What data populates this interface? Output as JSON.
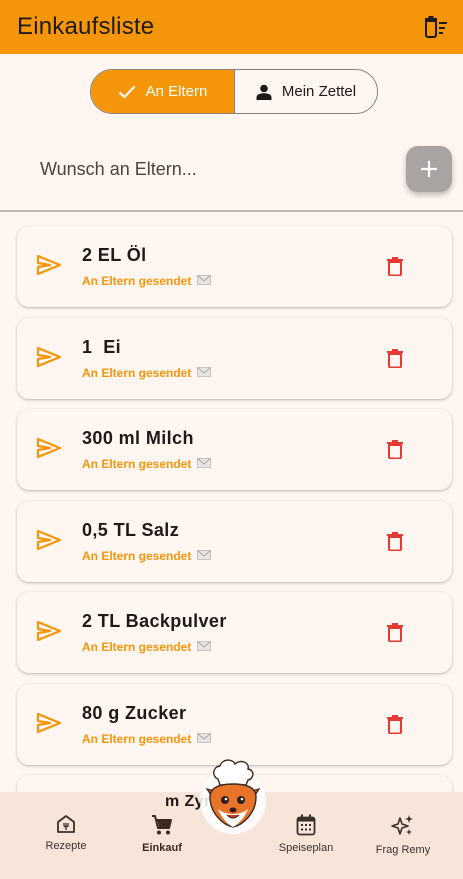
{
  "appbar": {
    "title": "Einkaufsliste",
    "clear_icon": "delete-sweep-icon"
  },
  "segments": [
    {
      "label": "An Eltern",
      "icon": "check-icon",
      "selected": true
    },
    {
      "label": "Mein Zettel",
      "icon": "person-icon",
      "selected": false
    }
  ],
  "wish": {
    "placeholder": "Wunsch an Eltern...",
    "value": "",
    "add_icon": "plus-icon"
  },
  "items": [
    {
      "name": "2 EL Öl",
      "status": "An Eltern gesendet"
    },
    {
      "name": "1  Ei",
      "status": "An Eltern gesendet"
    },
    {
      "name": "300 ml Milch",
      "status": "An Eltern gesendet"
    },
    {
      "name": "0,5 TL Salz",
      "status": "An Eltern gesendet"
    },
    {
      "name": "2 TL Backpulver",
      "status": "An Eltern gesendet"
    },
    {
      "name": "80 g Zucker",
      "status": "An Eltern gesendet"
    }
  ],
  "partial_item_text": "m  Zyr",
  "nav": [
    {
      "label": "Rezepte",
      "icon": "recipe-house-icon",
      "active": false
    },
    {
      "label": "Einkauf",
      "icon": "shopping-cart-icon",
      "active": true
    },
    {
      "label": "Speiseplan",
      "icon": "calendar-icon",
      "active": false
    },
    {
      "label": "Frag Remy",
      "icon": "sparkles-icon",
      "active": false
    }
  ],
  "colors": {
    "accent": "#f5960a",
    "background": "#fff5f1",
    "delete": "#e53935",
    "nav_bg": "#f7e5da"
  }
}
